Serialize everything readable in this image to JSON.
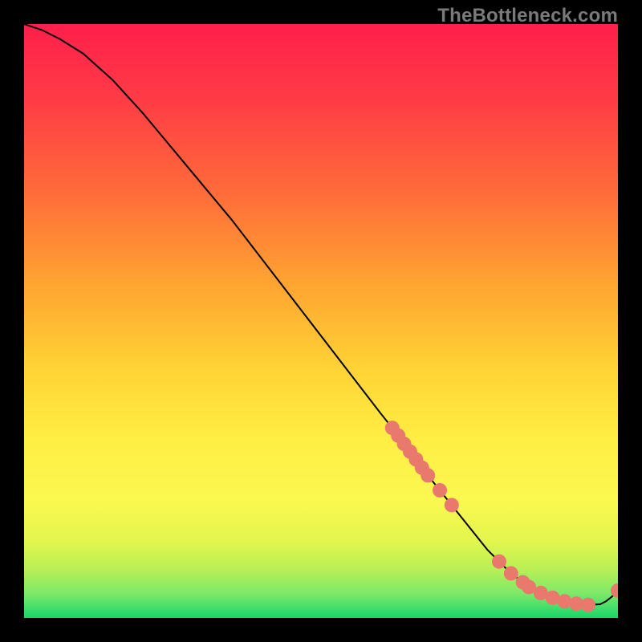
{
  "watermark": "TheBottleneck.com",
  "chart_data": {
    "type": "line",
    "title": "",
    "xlabel": "",
    "ylabel": "",
    "xlim": [
      0,
      100
    ],
    "ylim": [
      0,
      100
    ],
    "grid": false,
    "legend": false,
    "background_gradient": {
      "top_color": "#ff1f4b",
      "mid_colors": [
        "#ff6a3a",
        "#ffb031",
        "#ffe23a",
        "#fff94e",
        "#d7f54a",
        "#7be86a"
      ],
      "bottom_color": "#18d66a"
    },
    "series": [
      {
        "name": "curve",
        "type": "line",
        "color": "#000000",
        "x": [
          0,
          3,
          6,
          10,
          15,
          20,
          25,
          30,
          35,
          40,
          45,
          50,
          55,
          60,
          62,
          65,
          68,
          70,
          72,
          74,
          76,
          78,
          80,
          82,
          84,
          85,
          87,
          89,
          91,
          93,
          95,
          97,
          98,
          99,
          100
        ],
        "y": [
          100,
          99,
          97.5,
          95,
          90.5,
          85,
          79,
          73,
          67,
          60.5,
          54,
          47.5,
          41,
          34.5,
          32,
          28,
          24,
          21.5,
          19,
          16.5,
          14,
          11.5,
          9.5,
          7.5,
          6,
          5.2,
          4.2,
          3.4,
          2.8,
          2.4,
          2.2,
          2.3,
          2.8,
          3.6,
          4.6
        ]
      },
      {
        "name": "markers",
        "type": "scatter",
        "marker_color": "#e9786d",
        "marker_radius_px": 9,
        "x": [
          62,
          63,
          64,
          65,
          66,
          67,
          68,
          70,
          72,
          80,
          82,
          84,
          85,
          87,
          89,
          91,
          93,
          95,
          100
        ],
        "y": [
          32,
          30.7,
          29.3,
          28,
          26.7,
          25.3,
          24,
          21.5,
          19,
          9.5,
          7.5,
          6,
          5.2,
          4.2,
          3.4,
          2.8,
          2.4,
          2.2,
          4.6
        ]
      }
    ]
  }
}
